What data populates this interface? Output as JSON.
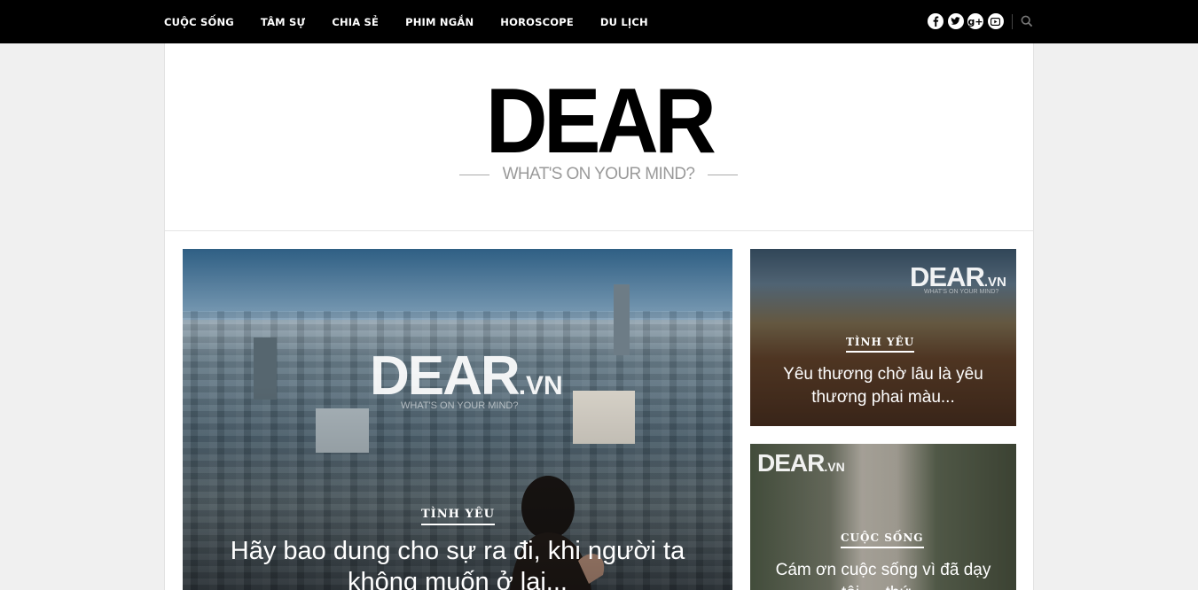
{
  "nav": {
    "items": [
      "CUỘC SỐNG",
      "TÂM SỰ",
      "CHIA SẺ",
      "PHIM NGẮN",
      "HOROSCOPE",
      "DU LỊCH"
    ]
  },
  "social": {
    "icons": [
      "facebook-icon",
      "twitter-icon",
      "google-plus-icon",
      "youtube-icon"
    ],
    "google_plus_glyph": "g+"
  },
  "header": {
    "logo": "DEAR",
    "tagline": "WHAT'S ON YOUR MIND?"
  },
  "watermark": {
    "brand": "DEAR",
    "suffix": ".VN",
    "sub": "WHAT'S ON YOUR MIND?"
  },
  "featured": {
    "category": "TÌNH YÊU",
    "title": "Hãy bao dung cho sự ra đi, khi người ta không muốn ở lại..."
  },
  "side_posts": [
    {
      "category": "TÌNH YÊU",
      "title": "Yêu thương chờ lâu là yêu thương phai màu..."
    },
    {
      "category": "CUỘC SỐNG",
      "title": "Cám ơn cuộc sống vì đã dạy tôi … thứ..."
    }
  ],
  "colors": {
    "topbar": "#000000",
    "page_background": "#f0f0f0",
    "content_background": "#ffffff",
    "logo": "#000000",
    "tagline": "#9a9a9a"
  }
}
